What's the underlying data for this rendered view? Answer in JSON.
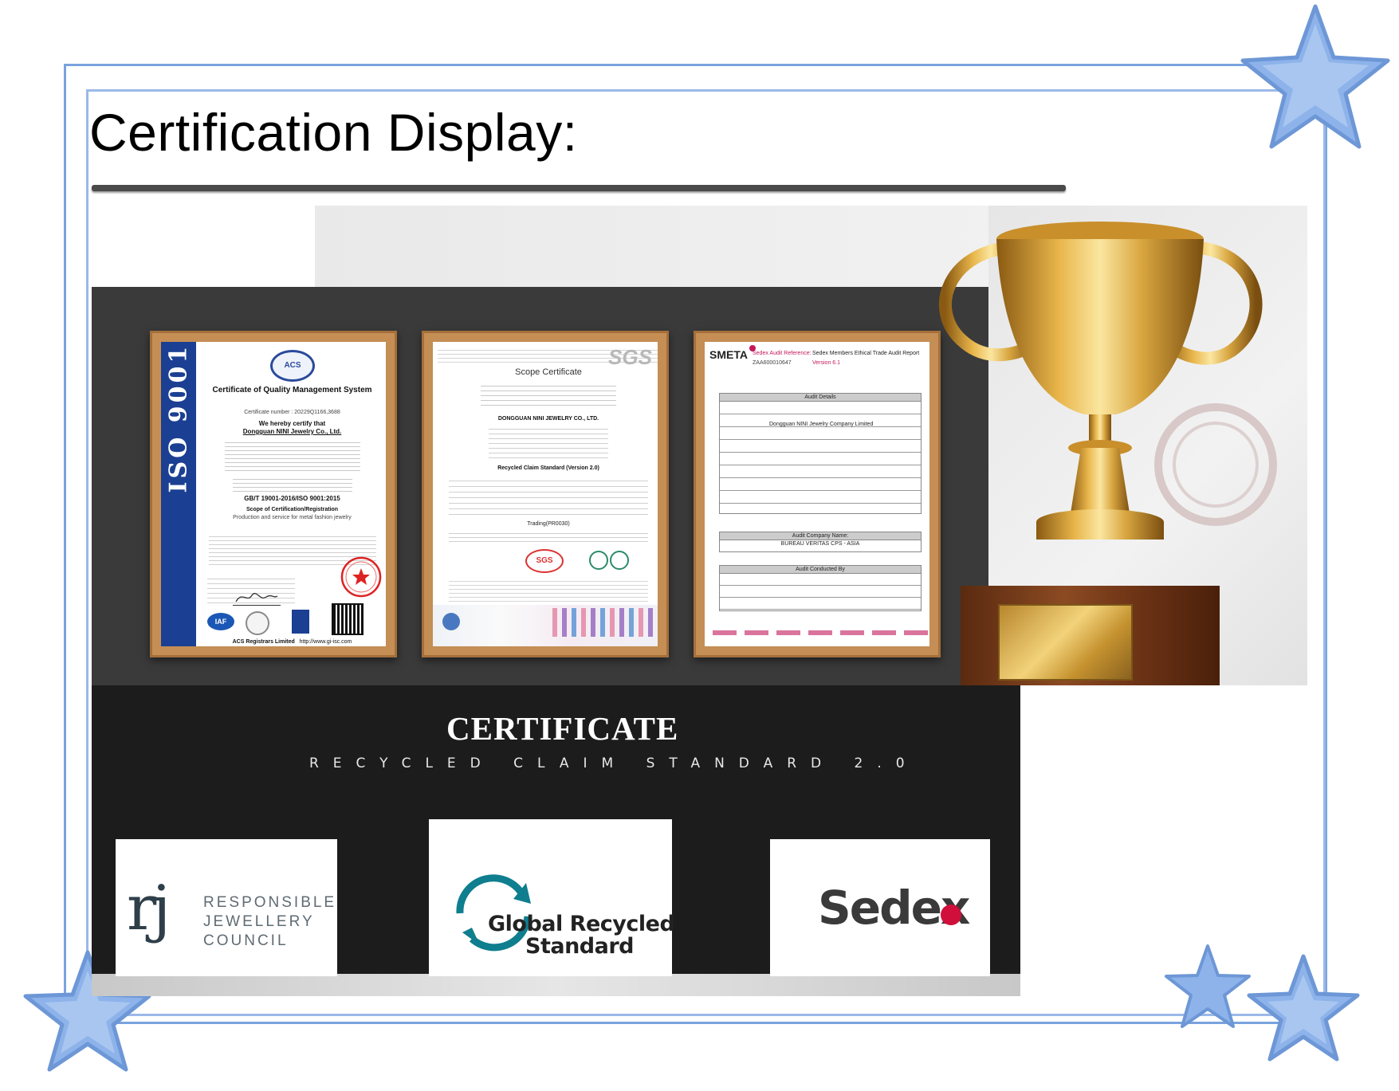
{
  "page": {
    "title": "Certification Display:"
  },
  "certificates": {
    "iso": {
      "side_label": "ISO 9001",
      "logo": "ACS",
      "title": "Certificate of Quality Management System",
      "number": "Certificate number : 20229Q1166,3688",
      "certify": "We hereby certify that",
      "company": "Dongguan NINI Jewelry Co., Ltd.",
      "standard": "GB/T 19001-2016/ISO 9001:2015",
      "scope_title": "Scope of Certification/Registration",
      "scope": "Production and service for metal fashion jewelry",
      "registrar": "ACS Registrars Limited",
      "url": "http://www.gi-isc.com",
      "badge_iaf": "IAF"
    },
    "sgs": {
      "brand": "SGS",
      "title": "Scope Certificate",
      "company": "DONGGUAN NINI JEWELRY CO., LTD.",
      "standard": "Recycled Claim Standard (Version 2.0)",
      "trading": "Trading(PR0030)",
      "stamp": "SGS"
    },
    "smeta": {
      "brand": "SMETA",
      "audit_ref_label": "Sedex Audit Reference:",
      "report_title": "Sedex Members Ethical Trade Audit Report",
      "version": "Version 6.1",
      "ref": "ZAA600010647",
      "section_details": "Audit Details",
      "business_name": "Dongguan NINI Jewelry Company Limited",
      "company_label": "Audit Company Name:",
      "company": "BUREAU VERITAS CPS - ASIA",
      "conducted": "Audit Conducted By"
    }
  },
  "banner": {
    "heading": "CERTIFICATE",
    "subheading": "RECYCLED CLAIM STANDARD 2.0"
  },
  "logos": {
    "rjc": {
      "mark": "rj",
      "line1": "RESPONSIBLE",
      "line2": "JEWELLERY",
      "line3": "COUNCIL"
    },
    "grs": {
      "line1": "Global Recycled",
      "line2": "Standard"
    },
    "sedex": {
      "text": "Sedex"
    }
  },
  "colors": {
    "frame": "#7aa3de",
    "star": "#8db3ea",
    "iso_band": "#1b3f92",
    "gold": "#d9a640"
  }
}
